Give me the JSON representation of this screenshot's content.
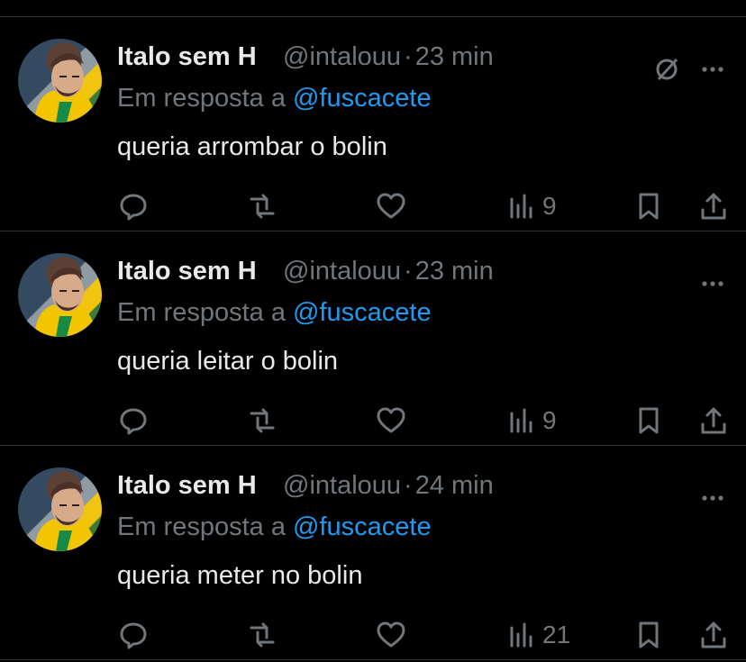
{
  "tweets": [
    {
      "name": "Italo sem H",
      "handle": "@intalouu",
      "separator": "·",
      "time": "23 min",
      "reply_prefix": "Em resposta a",
      "reply_to": "@fuscacete",
      "text": "queria arrombar o bolin",
      "views": "9",
      "show_muted_icon": true
    },
    {
      "name": "Italo sem H",
      "handle": "@intalouu",
      "separator": "·",
      "time": "23 min",
      "reply_prefix": "Em resposta a",
      "reply_to": "@fuscacete",
      "text": "queria leitar o bolin",
      "views": "9",
      "show_muted_icon": false
    },
    {
      "name": "Italo sem H",
      "handle": "@intalouu",
      "separator": "·",
      "time": "24 min",
      "reply_prefix": "Em resposta a",
      "reply_to": "@fuscacete",
      "text": "queria meter no bolin",
      "views": "21",
      "show_muted_icon": false
    }
  ],
  "icons": {
    "avatar": "profile-photo",
    "muted": "muted-icon",
    "more": "more-options-icon",
    "reply": "reply-icon",
    "retweet": "retweet-icon",
    "like": "heart-icon",
    "views": "views-icon",
    "bookmark": "bookmark-icon",
    "share": "share-icon"
  },
  "colors": {
    "background": "#000000",
    "primary_text": "#e7e9ea",
    "secondary_text": "#71767b",
    "mention": "#1d9bf0",
    "divider": "#2f3336"
  }
}
